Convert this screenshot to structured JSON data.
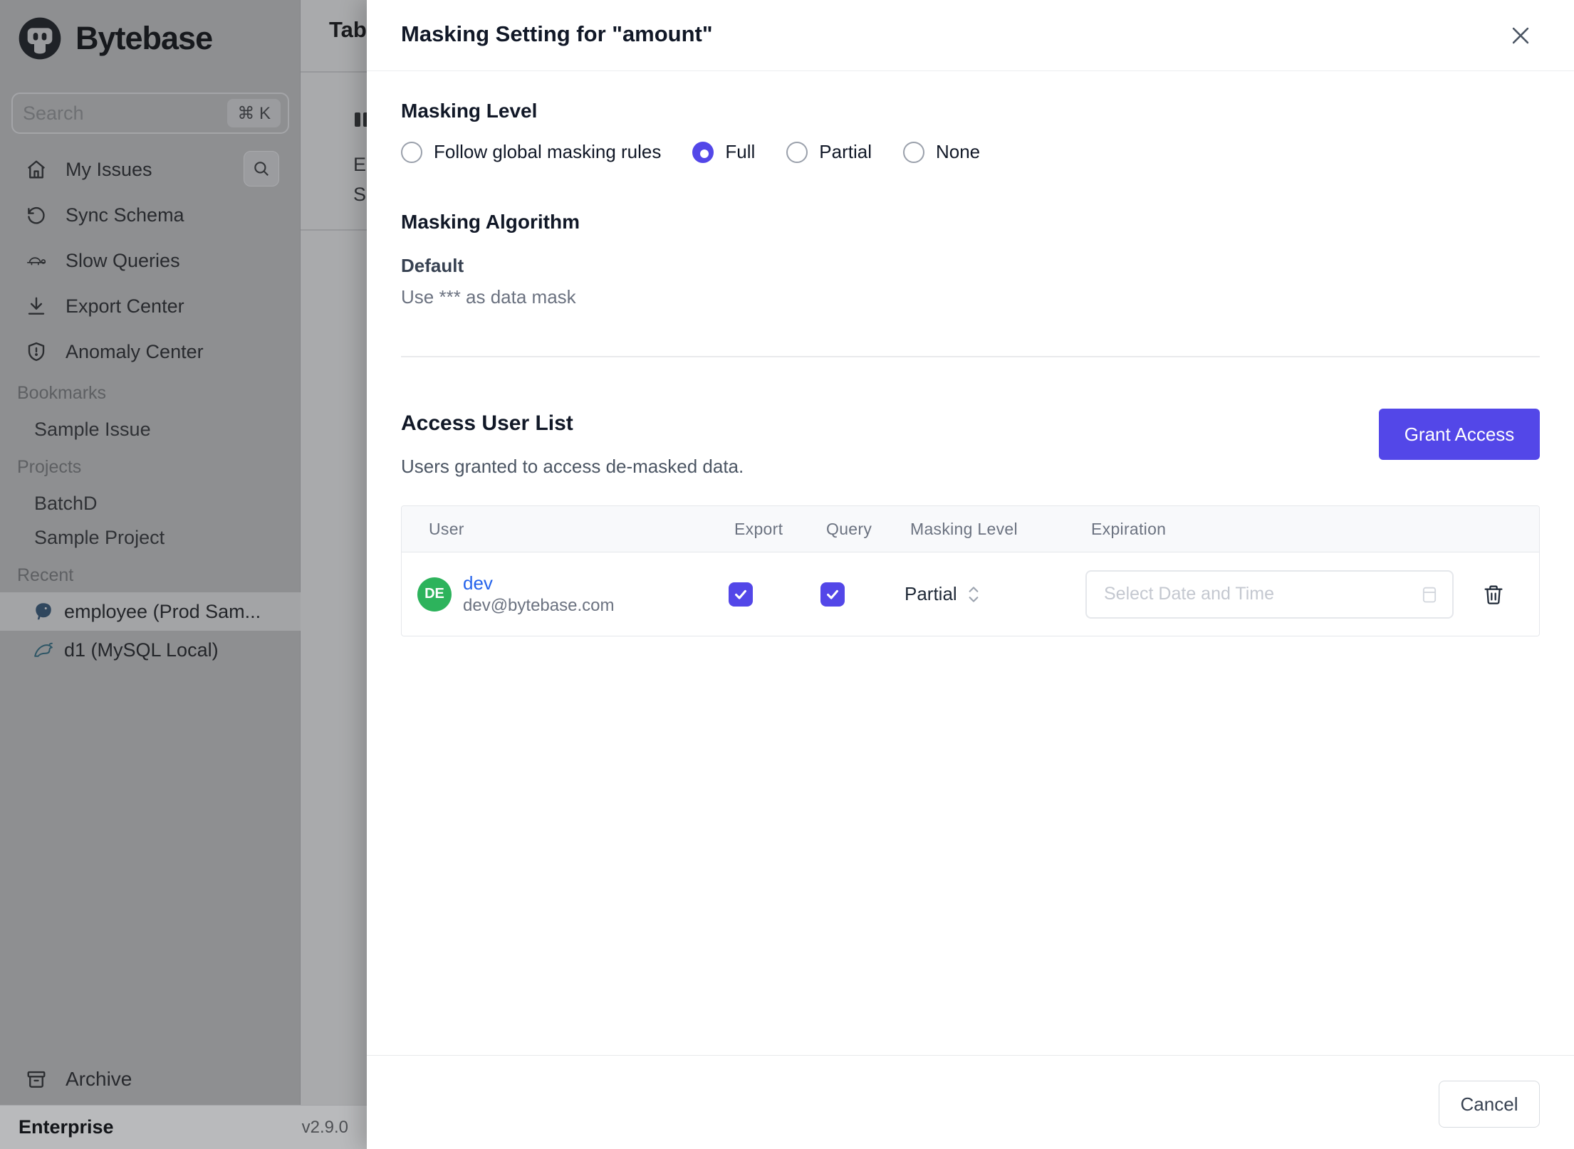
{
  "colors": {
    "accent": "#5347e8",
    "avatar_green": "#2db35c",
    "link_blue": "#2563eb"
  },
  "sidebar": {
    "logo_text": "Bytebase",
    "logo_icon": "bytebase-mascot-icon",
    "search": {
      "placeholder": "Search",
      "shortcut": "⌘ K"
    },
    "nav": [
      {
        "label": "My Issues",
        "icon": "home-icon"
      },
      {
        "label": "Sync Schema",
        "icon": "sync-icon"
      },
      {
        "label": "Slow Queries",
        "icon": "turtle-icon"
      },
      {
        "label": "Export Center",
        "icon": "download-icon"
      },
      {
        "label": "Anomaly Center",
        "icon": "shield-icon"
      }
    ],
    "issue_search_icon": "search-icon",
    "sections": [
      {
        "label": "Bookmarks",
        "items": [
          {
            "label": "Sample Issue"
          }
        ]
      },
      {
        "label": "Projects",
        "items": [
          {
            "label": "BatchD"
          },
          {
            "label": "Sample Project"
          }
        ]
      },
      {
        "label": "Recent",
        "items": [
          {
            "label": "employee (Prod Sam...",
            "icon": "postgres-icon",
            "active": true
          },
          {
            "label": "d1 (MySQL Local)",
            "icon": "mysql-icon",
            "active": false
          }
        ]
      }
    ],
    "archive_label": "Archive",
    "footer": {
      "plan": "Enterprise",
      "version": "v2.9.0"
    }
  },
  "background_page": {
    "header_truncated": "Tab",
    "line1": "E",
    "line2": "S"
  },
  "drawer": {
    "title": "Masking Setting for \"amount\"",
    "masking_level": {
      "heading": "Masking Level",
      "options": [
        {
          "label": "Follow global masking rules",
          "selected": false
        },
        {
          "label": "Full",
          "selected": true
        },
        {
          "label": "Partial",
          "selected": false
        },
        {
          "label": "None",
          "selected": false
        }
      ]
    },
    "masking_algorithm": {
      "heading": "Masking Algorithm",
      "name": "Default",
      "description": "Use *** as data mask"
    },
    "access_user_list": {
      "heading": "Access User List",
      "subtext": "Users granted to access de-masked data.",
      "grant_button": "Grant Access",
      "table": {
        "columns": [
          "User",
          "Export",
          "Query",
          "Masking Level",
          "Expiration"
        ],
        "rows": [
          {
            "avatar_initials": "DE",
            "name": "dev",
            "email": "dev@bytebase.com",
            "export_checked": true,
            "query_checked": true,
            "masking_level": "Partial",
            "expiration_placeholder": "Select Date and Time"
          }
        ]
      }
    },
    "footer": {
      "cancel_label": "Cancel"
    }
  }
}
